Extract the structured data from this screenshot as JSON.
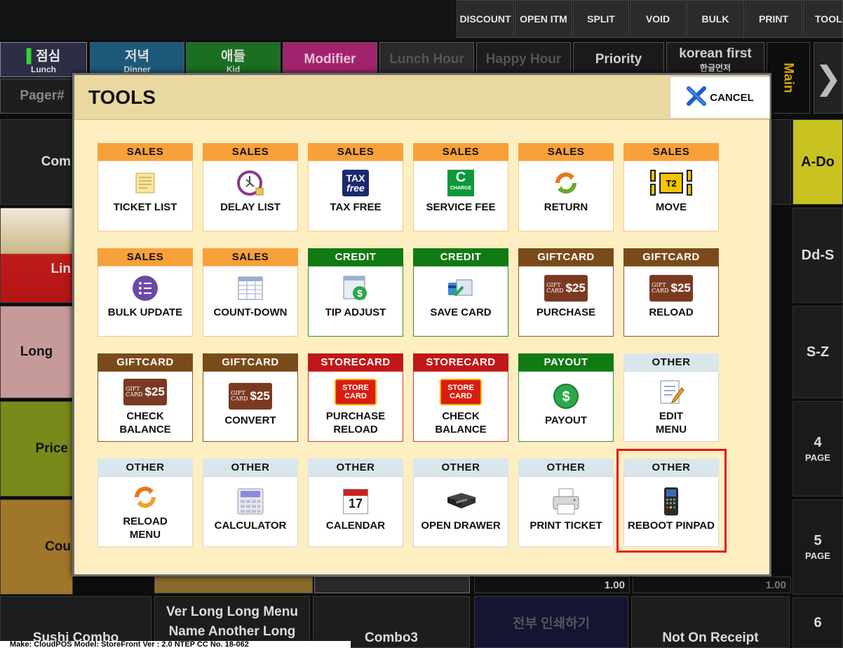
{
  "topbar": {
    "buttons": [
      "DISCOUNT",
      "OPEN ITM",
      "SPLIT",
      "VOID",
      "BULK",
      "PRINT",
      "TOOL"
    ]
  },
  "categories": [
    {
      "label": "점심",
      "sub": "Lunch",
      "color": "#2d2d44"
    },
    {
      "label": "저녁",
      "sub": "Dinner",
      "color": "#1d5a7a"
    },
    {
      "label": "애들",
      "sub": "Kid",
      "color": "#1c6e22"
    },
    {
      "label": "Modifier",
      "sub": "",
      "color": "#a3226d"
    },
    {
      "label": "Lunch Hour",
      "sub": "",
      "color": "#2a2a2a"
    },
    {
      "label": "Happy Hour",
      "sub": "",
      "color": "#1d1d1d"
    },
    {
      "label": "Priority",
      "sub": "",
      "color": "#1a1a1a"
    },
    {
      "label": "korean first",
      "sub": "한글먼저",
      "color": "#1a1a1a"
    }
  ],
  "pager_label": "Pager#",
  "main_label": "Main",
  "background_tiles": {
    "left": [
      "Com",
      "Lin",
      "Long",
      "Price",
      "Cou"
    ],
    "right": [
      "A-Do",
      "Dd-S",
      "S-Z"
    ],
    "pages": [
      {
        "num": "4",
        "label": "PAGE"
      },
      {
        "num": "5",
        "label": "PAGE"
      },
      {
        "num": "6",
        "label": ""
      }
    ],
    "bottom": [
      "Sushi Combo",
      "Ver Long Long Menu\nName Another Long",
      "Combo3",
      "전부 인쇄하기",
      "Not On Receipt"
    ],
    "prices": [
      "1.00",
      "1.00"
    ]
  },
  "status_line": "Make: CloudPOS  Model: StoreFront  Ver : 2.0  NTEP CC No. 18-062",
  "modal": {
    "title": "TOOLS",
    "cancel_label": "CANCEL",
    "tools": [
      {
        "category": "SALES",
        "label": "TICKET LIST",
        "icon": "ticket-list-icon"
      },
      {
        "category": "SALES",
        "label": "DELAY LIST",
        "icon": "delay-clock-icon"
      },
      {
        "category": "SALES",
        "label": "TAX FREE",
        "icon": "tax-free-icon"
      },
      {
        "category": "SALES",
        "label": "SERVICE FEE",
        "icon": "service-charge-icon"
      },
      {
        "category": "SALES",
        "label": "RETURN",
        "icon": "return-arrows-icon"
      },
      {
        "category": "SALES",
        "label": "MOVE",
        "icon": "move-table-icon"
      },
      {
        "category": "SALES",
        "label": "BULK UPDATE",
        "icon": "bulk-update-list-icon"
      },
      {
        "category": "SALES",
        "label": "COUNT-DOWN",
        "icon": "count-down-table-icon"
      },
      {
        "category": "CREDIT",
        "label": "TIP ADJUST",
        "icon": "tip-adjust-icon"
      },
      {
        "category": "CREDIT",
        "label": "SAVE CARD",
        "icon": "save-card-icon"
      },
      {
        "category": "GIFTCARD",
        "label": "PURCHASE",
        "icon": "gift-card-icon"
      },
      {
        "category": "GIFTCARD",
        "label": "RELOAD",
        "icon": "gift-card-icon"
      },
      {
        "category": "GIFTCARD",
        "label": "CHECK\nBALANCE",
        "icon": "gift-card-icon"
      },
      {
        "category": "GIFTCARD",
        "label": "CONVERT",
        "icon": "gift-card-icon"
      },
      {
        "category": "STORECARD",
        "label": "PURCHASE\nRELOAD",
        "icon": "store-card-icon"
      },
      {
        "category": "STORECARD",
        "label": "CHECK\nBALANCE",
        "icon": "store-card-icon"
      },
      {
        "category": "PAYOUT",
        "label": "PAYOUT",
        "icon": "payout-dollar-icon"
      },
      {
        "category": "OTHER",
        "label": "EDIT\nMENU",
        "icon": "edit-menu-icon"
      },
      {
        "category": "OTHER",
        "label": "RELOAD\nMENU",
        "icon": "reload-arrows-icon"
      },
      {
        "category": "OTHER",
        "label": "CALCULATOR",
        "icon": "calculator-icon"
      },
      {
        "category": "OTHER",
        "label": "CALENDAR",
        "icon": "calendar-icon"
      },
      {
        "category": "OTHER",
        "label": "OPEN DRAWER",
        "icon": "cash-drawer-icon"
      },
      {
        "category": "OTHER",
        "label": "PRINT TICKET",
        "icon": "printer-icon"
      },
      {
        "category": "OTHER",
        "label": "REBOOT PINPAD",
        "icon": "pinpad-icon"
      }
    ],
    "icon_text": {
      "tax": "TAX",
      "free": "free",
      "charge_letter": "C",
      "charge": "CHARGE",
      "move": "T2",
      "gift_small": "GIFT",
      "gift_small2": "CARD",
      "gift_amount": "$25",
      "store1": "STORE",
      "store2": "CARD",
      "calendar_day": "17"
    }
  },
  "colors": {
    "modal_bg": "#fdefc2",
    "sales": "#f8a13a",
    "credit": "#127a12",
    "giftcard": "#7a4b1a",
    "storecard": "#c01818",
    "other": "#d9e6ec",
    "highlight": "#e41a1a"
  }
}
